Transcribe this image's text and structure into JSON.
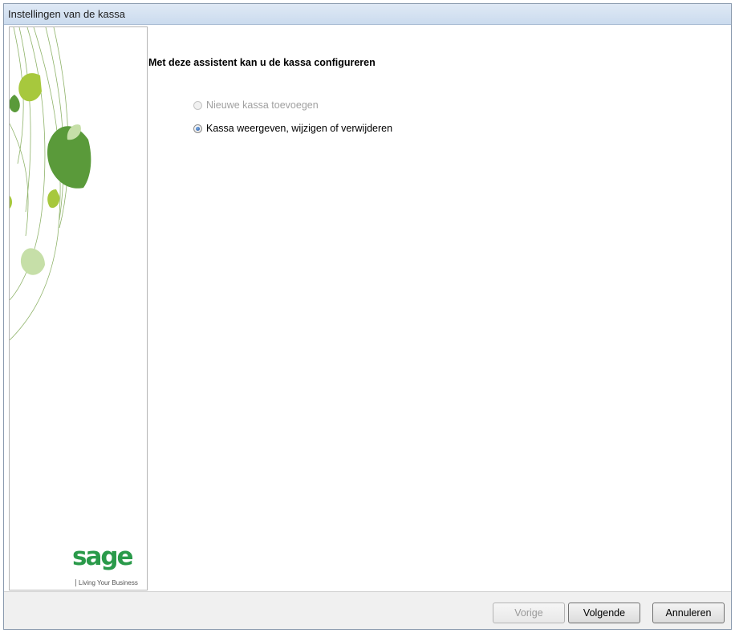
{
  "window": {
    "title": "Instellingen van de kassa"
  },
  "sidebar": {
    "logo_text": "sage",
    "tagline": "Living Your Business"
  },
  "content": {
    "heading": "Met deze assistent kan u de kassa configureren",
    "options": [
      {
        "label": "Nieuwe kassa toevoegen",
        "selected": false,
        "enabled": false
      },
      {
        "label": "Kassa weergeven, wijzigen of verwijderen",
        "selected": true,
        "enabled": true
      }
    ]
  },
  "footer": {
    "back_label": "Vorige",
    "next_label": "Volgende",
    "cancel_label": "Annuleren"
  },
  "colors": {
    "brand_green": "#2a9a4a",
    "leaf_light": "#a7c83d",
    "leaf_dark": "#5a9a3a"
  }
}
